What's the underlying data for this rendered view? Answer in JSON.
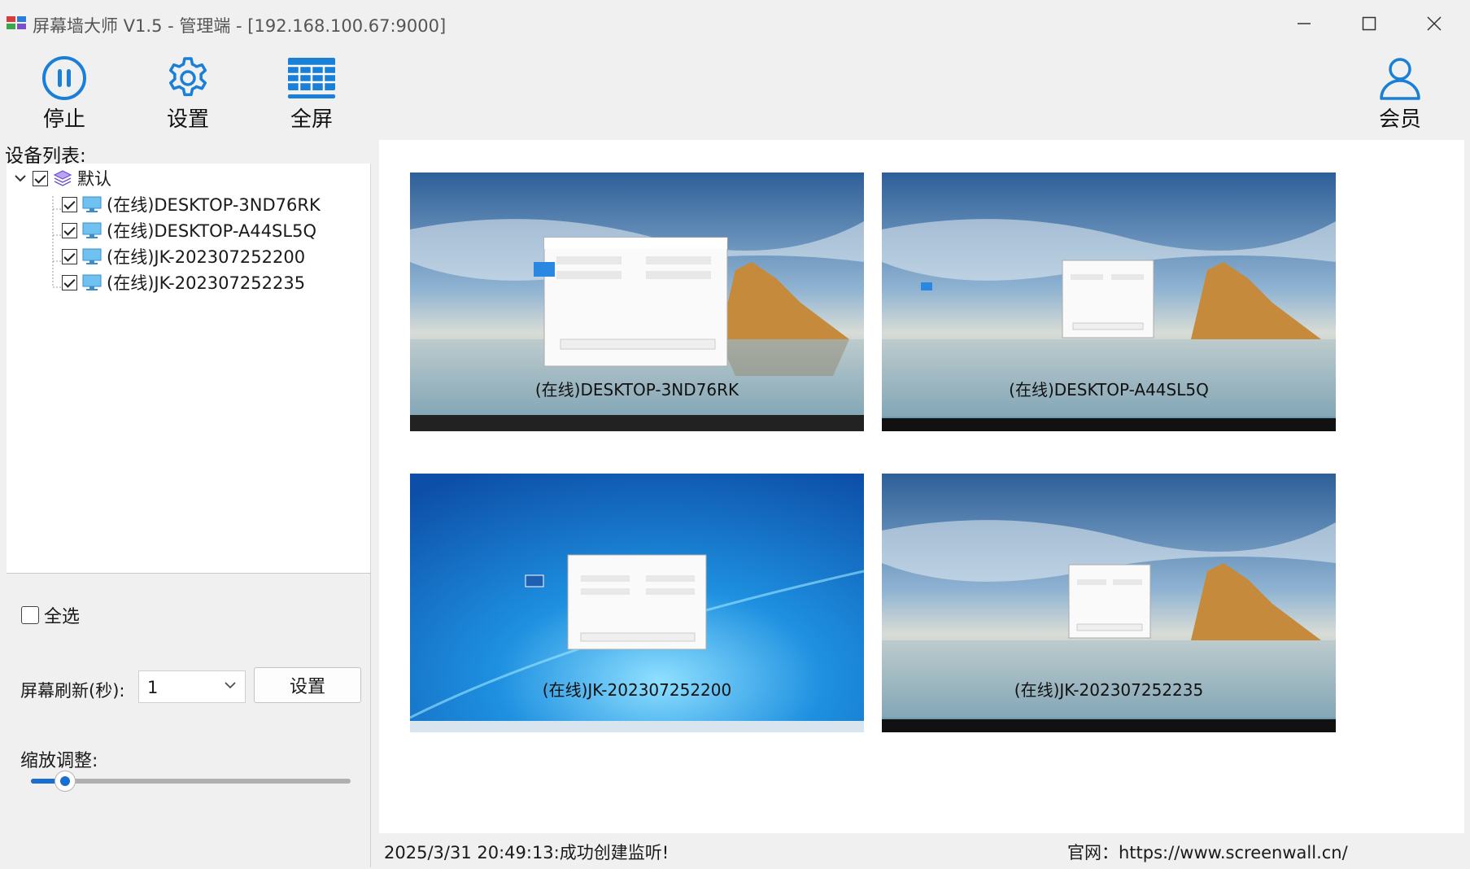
{
  "window": {
    "title": "屏幕墙大师 V1.5 - 管理端 - [192.168.100.67:9000]",
    "controls": [
      "minimize-icon",
      "maximize-icon",
      "close-icon"
    ]
  },
  "toolbar": {
    "stop_label": "停止",
    "settings_label": "设置",
    "fullscreen_label": "全屏",
    "member_label": "会员",
    "accent": "#1a7fd6"
  },
  "sidebar": {
    "title": "设备列表:",
    "group": {
      "label": "默认",
      "checked": true,
      "expanded": true
    },
    "devices": [
      {
        "label": "(在线)DESKTOP-3ND76RK",
        "checked": true
      },
      {
        "label": "(在线)DESKTOP-A44SL5Q",
        "checked": true
      },
      {
        "label": "(在线)JK-202307252200",
        "checked": true
      },
      {
        "label": "(在线)JK-202307252235",
        "checked": true
      }
    ],
    "select_all_label": "全选",
    "select_all_checked": false,
    "refresh_label": "屏幕刷新(秒):",
    "refresh_value": "1",
    "set_button": "设置",
    "zoom_label": "缩放调整:",
    "zoom_level": 0.08
  },
  "screens": [
    {
      "caption": "(在线)DESKTOP-3ND76RK",
      "wallpaper": "win10-lake"
    },
    {
      "caption": "(在线)DESKTOP-A44SL5Q",
      "wallpaper": "win10-lake"
    },
    {
      "caption": "(在线)JK-202307252200",
      "wallpaper": "win7-blue"
    },
    {
      "caption": "(在线)JK-202307252235",
      "wallpaper": "win10-lake"
    }
  ],
  "status": {
    "message": "2025/3/31 20:49:13:成功创建监听!",
    "website": "官网：https://www.screenwall.cn/"
  }
}
